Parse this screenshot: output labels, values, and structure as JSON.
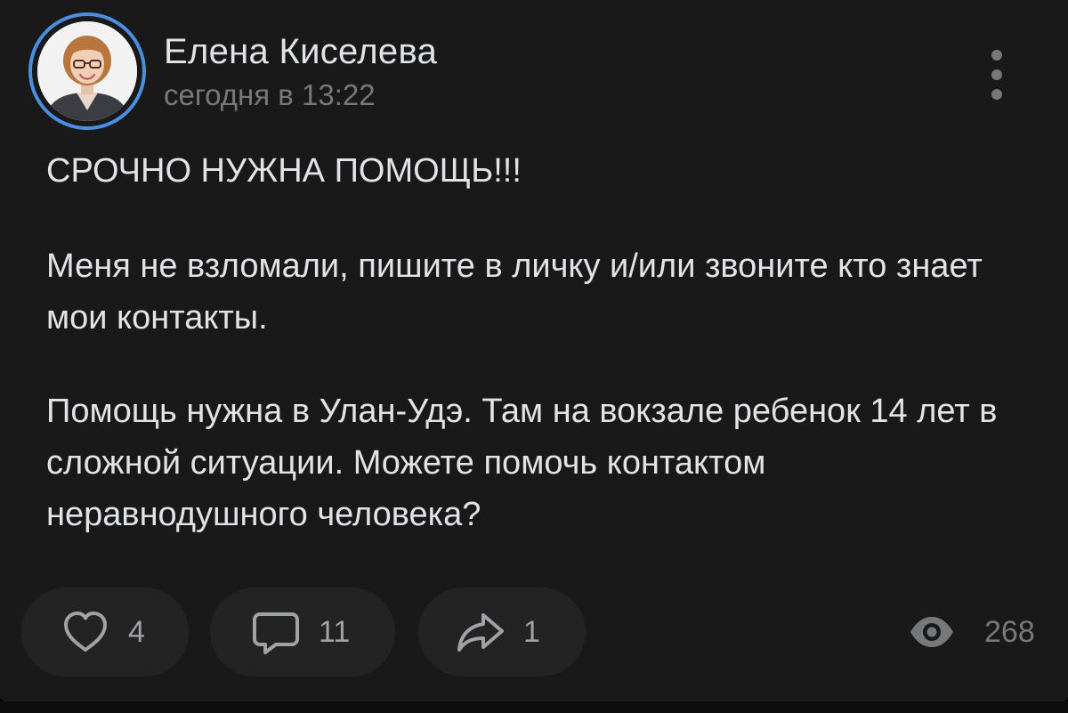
{
  "post": {
    "author": "Елена Киселева",
    "time": "сегодня в 13:22",
    "paragraphs": [
      "СРОЧНО НУЖНА ПОМОЩЬ!!!",
      "Меня не взломали, пишите в личку и/или звоните кто знает мои контакты.",
      "Помощь нужна в Улан-Удэ. Там на вокзале ребенок 14 лет в сложной ситуации. Можете помочь контактом неравнодушного человека?"
    ]
  },
  "actions": {
    "likes": "4",
    "comments": "11",
    "shares": "1",
    "views": "268"
  },
  "icons": {
    "like": "heart-icon",
    "comment": "comment-bubble-icon",
    "share": "share-arrow-icon",
    "views": "eye-icon",
    "more": "more-vertical-icon"
  },
  "colors": {
    "card_background": "#19191a",
    "avatar_ring": "#4a8fe2",
    "primary_text": "#e1e3e6",
    "secondary_text": "#76787a",
    "pill_background": "#232324"
  }
}
